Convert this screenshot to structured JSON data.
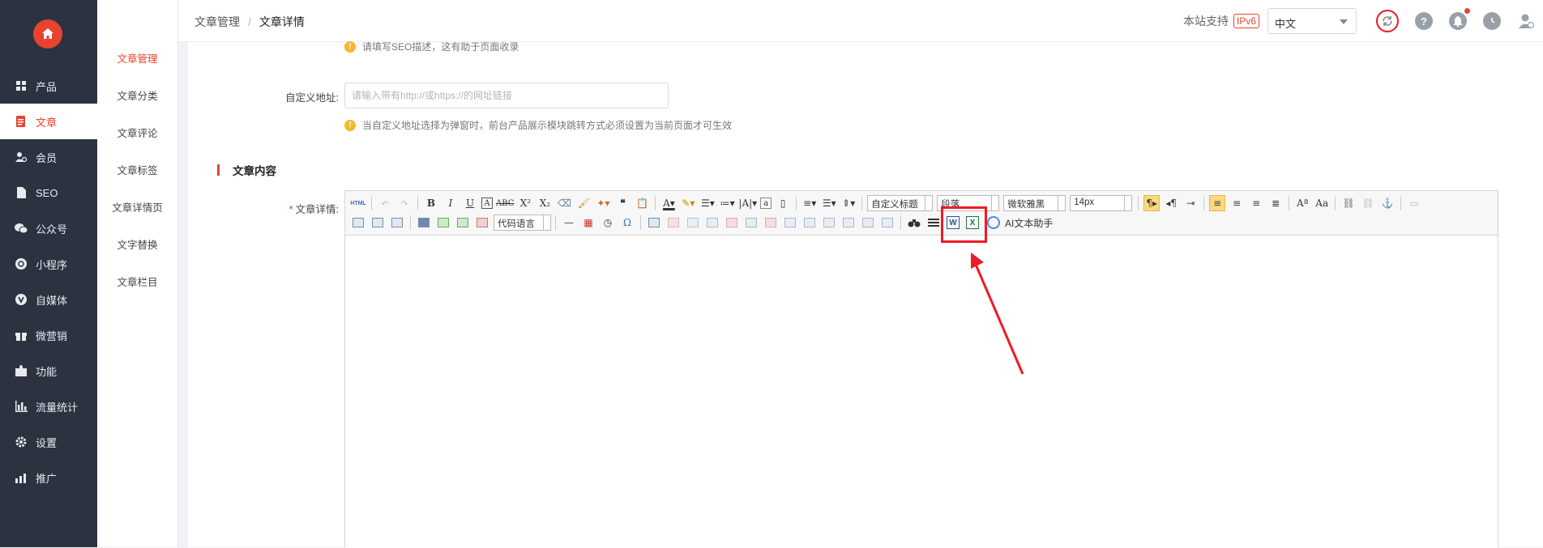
{
  "sidebar": {
    "items": [
      {
        "label": "产品",
        "icon": "grid-icon"
      },
      {
        "label": "文章",
        "icon": "document-icon",
        "active": true
      },
      {
        "label": "会员",
        "icon": "user-icon"
      },
      {
        "label": "SEO",
        "icon": "file-icon"
      },
      {
        "label": "公众号",
        "icon": "wechat-icon"
      },
      {
        "label": "小程序",
        "icon": "miniprogram-icon"
      },
      {
        "label": "自媒体",
        "icon": "v-icon"
      },
      {
        "label": "微营销",
        "icon": "gift-icon"
      },
      {
        "label": "功能",
        "icon": "puzzle-icon"
      },
      {
        "label": "流量统计",
        "icon": "bar-chart-icon"
      },
      {
        "label": "设置",
        "icon": "gear-icon"
      },
      {
        "label": "推广",
        "icon": "promote-icon"
      }
    ]
  },
  "subnav": {
    "items": [
      "文章管理",
      "文章分类",
      "文章评论",
      "文章标签",
      "文章详情页",
      "文字替换",
      "文章栏目"
    ],
    "active_index": 0
  },
  "header": {
    "breadcrumb": [
      "文章管理",
      "文章详情"
    ],
    "support_text": "本站支持",
    "ipv6_badge": "IPv6",
    "language": "中文"
  },
  "form": {
    "seo_hint": "请填写SEO描述，这有助于页面收录",
    "custom_url_label": "自定义地址:",
    "custom_url_placeholder": "请输入带有http://或https://的网址链接",
    "custom_url_hint": "当自定义地址选择为弹窗时，前台产品展示模块跳转方式必须设置为当前页面才可生效",
    "section_title": "文章内容",
    "detail_label": "文章详情:"
  },
  "editor": {
    "custom_title_combo": "自定义标题",
    "paragraph_combo": "段落",
    "font_combo": "微软雅黑",
    "size_combo": "14px",
    "code_lang_combo": "代码语言",
    "ai_label": "AI文本助手",
    "word_label": "W",
    "excel_label": "X"
  },
  "annotation_color": "#ee1b24"
}
